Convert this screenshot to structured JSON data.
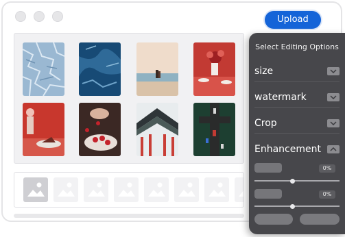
{
  "window": {
    "traffic_lights": [
      "close-dot",
      "minimize-dot",
      "maximize-dot"
    ]
  },
  "toolbar": {
    "upload_label": "Upload",
    "accent_color": "#1464d8"
  },
  "gallery": {
    "images": [
      {
        "name": "ice-texture",
        "colors": [
          "#8fb0cc",
          "#c3d6e6"
        ]
      },
      {
        "name": "blue-glacier",
        "colors": [
          "#133f66",
          "#3b79a6"
        ]
      },
      {
        "name": "beach-sunset",
        "colors": [
          "#e8d6c6",
          "#7fa7b9"
        ]
      },
      {
        "name": "red-table-flowers",
        "colors": [
          "#c23a33",
          "#f0e6e0"
        ]
      },
      {
        "name": "cake-and-flowers",
        "colors": [
          "#c73a2e",
          "#e9d9d0"
        ]
      },
      {
        "name": "strawberry-dessert",
        "colors": [
          "#3a2622",
          "#d8c6bc"
        ]
      },
      {
        "name": "temple-roof",
        "colors": [
          "#2b3136",
          "#c93e36"
        ]
      },
      {
        "name": "aerial-street",
        "colors": [
          "#1c3b2e",
          "#2a2a2a"
        ]
      }
    ]
  },
  "strip": {
    "placeholder_count": 8,
    "selected_index": 0,
    "icon": "image-placeholder-icon"
  },
  "panel": {
    "title": "Select Editing Options",
    "options": [
      {
        "label": "size",
        "state": "collapsed"
      },
      {
        "label": "watermark",
        "state": "collapsed"
      },
      {
        "label": "Crop",
        "state": "collapsed"
      },
      {
        "label": "Enhancement",
        "state": "expanded"
      }
    ],
    "enhancement": {
      "controls": [
        {
          "value_label": "0%",
          "level": 0.45
        },
        {
          "value_label": "0%",
          "level": 0.45
        }
      ]
    },
    "background": "#47474b"
  }
}
